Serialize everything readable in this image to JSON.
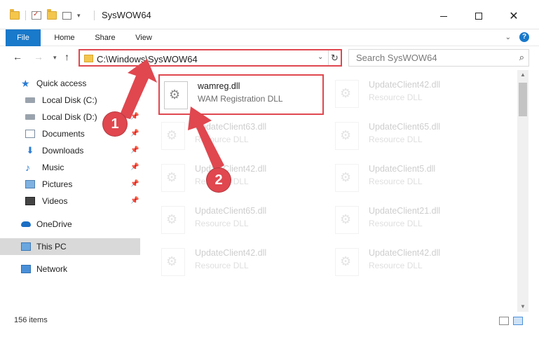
{
  "window": {
    "title": "SysWOW64",
    "minimize_glyph": "",
    "close_glyph": "✕"
  },
  "ribbon": {
    "tabs": [
      "File",
      "Home",
      "Share",
      "View"
    ]
  },
  "address": {
    "path": "C:\\Windows\\SysWOW64",
    "search_placeholder": "Search SysWOW64"
  },
  "sidebar": {
    "quick_access": "Quick access",
    "items": [
      {
        "label": "Local Disk (C:)",
        "icon": "drive-icon"
      },
      {
        "label": "Local Disk (D:)",
        "icon": "drive-icon"
      },
      {
        "label": "Documents",
        "icon": "documents-icon"
      },
      {
        "label": "Downloads",
        "icon": "downloads-icon"
      },
      {
        "label": "Music",
        "icon": "music-icon"
      },
      {
        "label": "Pictures",
        "icon": "pictures-icon"
      },
      {
        "label": "Videos",
        "icon": "videos-icon"
      }
    ],
    "onedrive": "OneDrive",
    "this_pc": "This PC",
    "network": "Network"
  },
  "files": [
    {
      "name": "wamreg.dll",
      "type": "WAM Registration DLL",
      "highlighted": true
    },
    {
      "name": "UpdateClient42.dll",
      "type": "Resource DLL"
    },
    {
      "name": "UpdateClient63.dll",
      "type": "Resource DLL"
    },
    {
      "name": "UpdateClient65.dll",
      "type": "Resource DLL"
    },
    {
      "name": "UpdateClient42.dll",
      "type": "Resource DLL"
    },
    {
      "name": "UpdateClient5.dll",
      "type": "Resource DLL"
    },
    {
      "name": "UpdateClient65.dll",
      "type": "Resource DLL"
    },
    {
      "name": "UpdateClient21.dll",
      "type": "Resource DLL"
    },
    {
      "name": "UpdateClient42.dll",
      "type": "Resource DLL"
    },
    {
      "name": "UpdateClient42.dll",
      "type": "Resource DLL"
    }
  ],
  "status": {
    "count": "156 items"
  },
  "annotations": {
    "step1": "1",
    "step2": "2",
    "color": "#e0474f"
  }
}
